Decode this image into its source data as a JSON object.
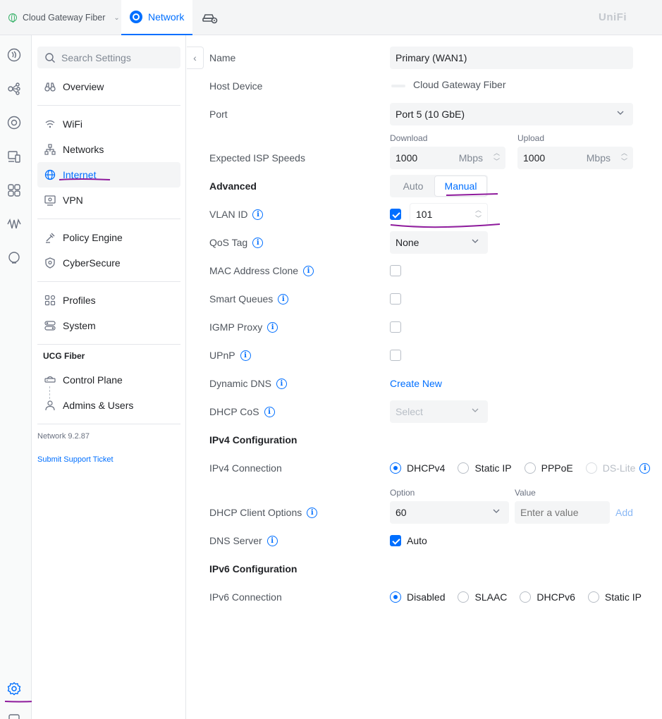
{
  "topbar": {
    "device_name": "Cloud Gateway Fiber",
    "app_tab": "Network",
    "brand": "UniFi"
  },
  "sidebar": {
    "search_placeholder": "Search Settings",
    "items": [
      {
        "label": "Overview",
        "icon": "binoculars-icon"
      },
      {
        "label": "WiFi",
        "icon": "wifi-icon"
      },
      {
        "label": "Networks",
        "icon": "network-tree-icon"
      },
      {
        "label": "Internet",
        "icon": "globe-icon",
        "active": true
      },
      {
        "label": "VPN",
        "icon": "vpn-icon"
      },
      {
        "label": "Policy Engine",
        "icon": "policy-icon"
      },
      {
        "label": "CyberSecure",
        "icon": "shield-icon"
      },
      {
        "label": "Profiles",
        "icon": "profiles-icon"
      },
      {
        "label": "System",
        "icon": "toggles-icon"
      }
    ],
    "ucg_section": "UCG Fiber",
    "ucg_items": [
      {
        "label": "Control Plane",
        "icon": "gateway-icon"
      },
      {
        "label": "Admins & Users",
        "icon": "user-icon"
      }
    ],
    "version": "Network 9.2.87",
    "support_link": "Submit Support Ticket"
  },
  "form": {
    "name_label": "Name",
    "name_value": "Primary (WAN1)",
    "host_label": "Host Device",
    "host_value": "Cloud Gateway Fiber",
    "port_label": "Port",
    "port_value": "Port 5 (10 GbE)",
    "speeds_label": "Expected ISP Speeds",
    "download_label": "Download",
    "download_value": "1000",
    "upload_label": "Upload",
    "upload_value": "1000",
    "speed_unit": "Mbps",
    "advanced_label": "Advanced",
    "advanced_options": [
      "Auto",
      "Manual"
    ],
    "advanced_selected": "Manual",
    "vlan_label": "VLAN ID",
    "vlan_enabled": true,
    "vlan_value": "101",
    "qos_label": "QoS Tag",
    "qos_value": "None",
    "mac_clone_label": "MAC Address Clone",
    "smart_queues_label": "Smart Queues",
    "igmp_label": "IGMP Proxy",
    "upnp_label": "UPnP",
    "ddns_label": "Dynamic DNS",
    "ddns_link": "Create New",
    "dhcp_cos_label": "DHCP CoS",
    "dhcp_cos_value": "Select",
    "ipv4_heading": "IPv4 Configuration",
    "ipv4_conn_label": "IPv4 Connection",
    "ipv4_options": [
      "DHCPv4",
      "Static IP",
      "PPPoE",
      "DS-Lite"
    ],
    "ipv4_selected": "DHCPv4",
    "dhcp_client_label": "DHCP Client Options",
    "option_label": "Option",
    "option_value": "60",
    "value_label": "Value",
    "value_placeholder": "Enter a value",
    "add_label": "Add",
    "dns_label": "DNS Server",
    "dns_auto_label": "Auto",
    "dns_auto": true,
    "ipv6_heading": "IPv6 Configuration",
    "ipv6_conn_label": "IPv6 Connection",
    "ipv6_options": [
      "Disabled",
      "SLAAC",
      "DHCPv6",
      "Static IP"
    ],
    "ipv6_selected": "Disabled"
  },
  "colors": {
    "accent": "#006fff",
    "annotation": "#8e1a9c"
  }
}
